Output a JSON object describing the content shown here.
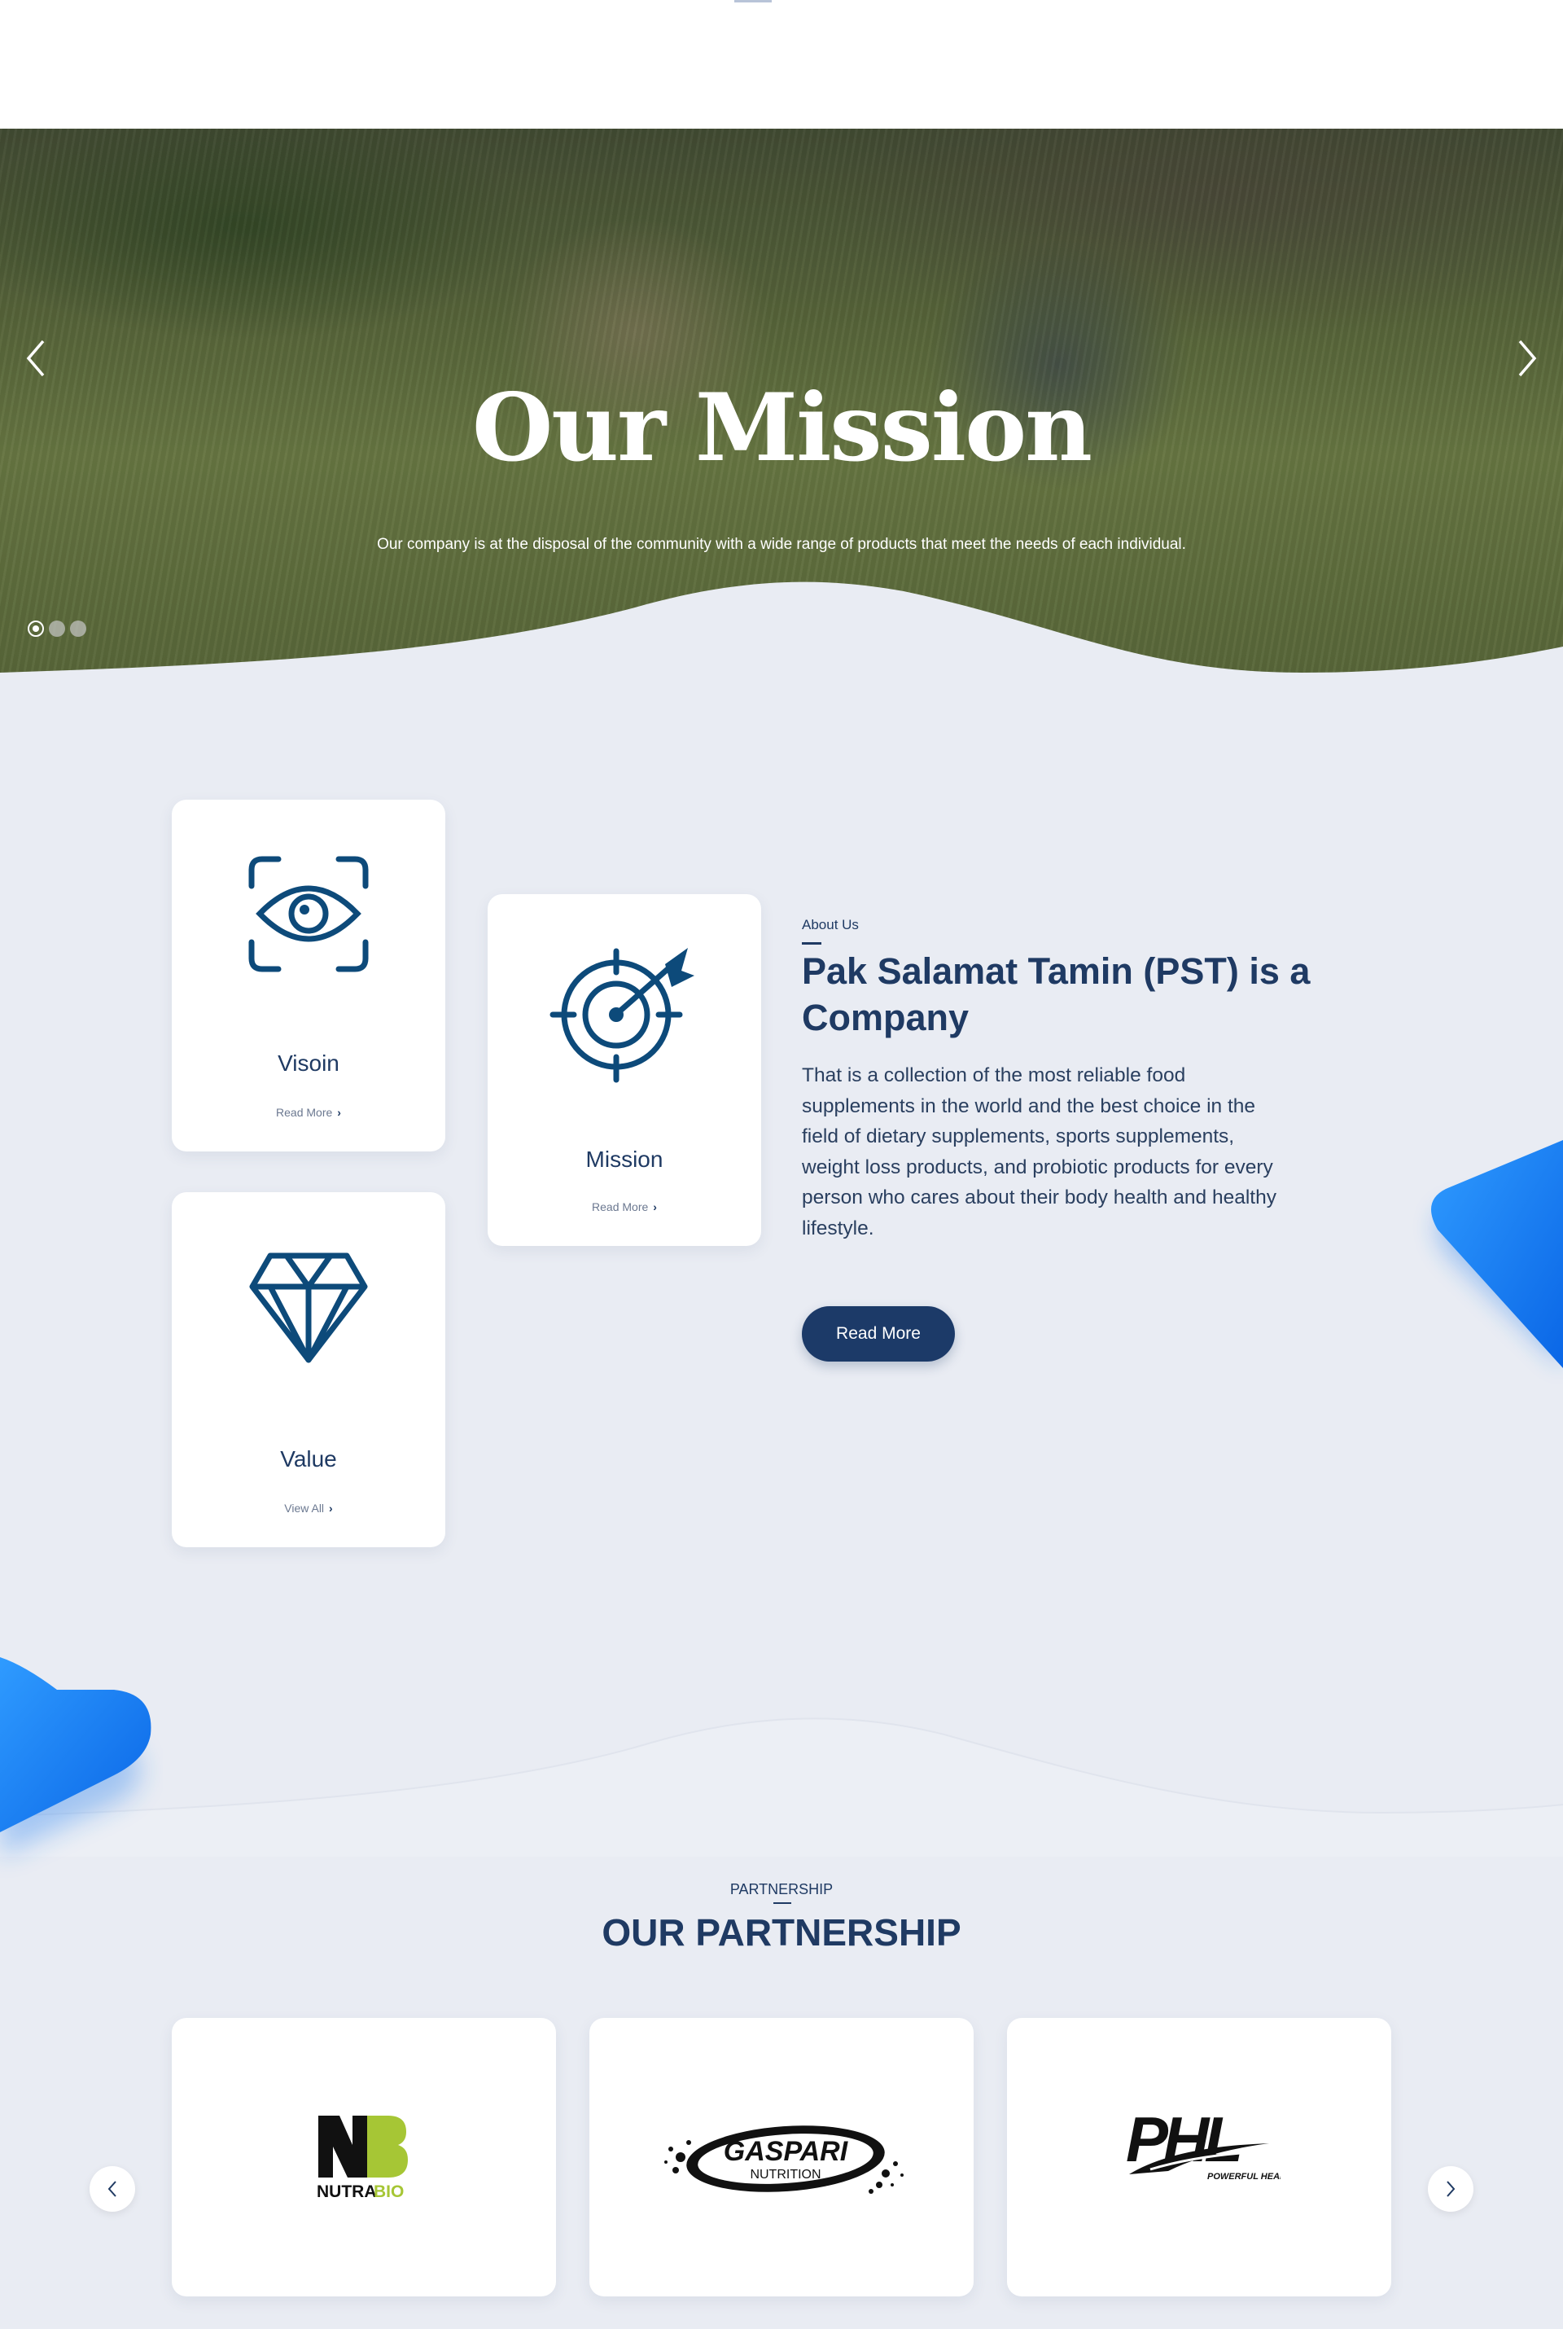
{
  "hero": {
    "title": "Our Mission",
    "subtitle": "Our company is at the disposal of the community with a wide range of products that meet the needs of each individual.",
    "prev_icon": "chevron-left-icon",
    "next_icon": "chevron-right-icon",
    "slide_count": 3,
    "active_slide": 1
  },
  "cards": {
    "vision": {
      "title": "Visoin",
      "link": "Read More",
      "icon": "eye-scan-icon"
    },
    "mission": {
      "title": "Mission",
      "link": "Read More",
      "icon": "target-arrow-icon"
    },
    "value": {
      "title": "Value",
      "link": "View All",
      "icon": "diamond-icon"
    }
  },
  "about": {
    "label": "About Us",
    "title": "Pak Salamat Tamin (PST) is a Company",
    "text": "That is a collection of the most reliable food supplements in the world and the best choice in the field of dietary supplements, sports supplements, weight loss products, and probiotic products for every person who cares about their body health and healthy lifestyle.",
    "button": "Read More"
  },
  "partnership": {
    "label": "PARTNERSHIP",
    "title": "OUR PARTNERSHIP",
    "partners": [
      {
        "name": "NUTRABIO",
        "logo_text_a": "NUTRA",
        "logo_text_b": "BIO"
      },
      {
        "name": "GASPARI NUTRITION",
        "logo_text_a": "GASPARI",
        "logo_text_b": "NUTRITION"
      },
      {
        "name": "PHL",
        "logo_text_a": "PHL",
        "logo_text_b": "POWERFUL HEALTHY LIVING"
      }
    ]
  },
  "colors": {
    "navy": "#1f3a63",
    "button": "#1c3a68",
    "accent_blue": "#1a7cf0",
    "background": "#e9ecf3",
    "nutrabio_green": "#a6c635"
  }
}
